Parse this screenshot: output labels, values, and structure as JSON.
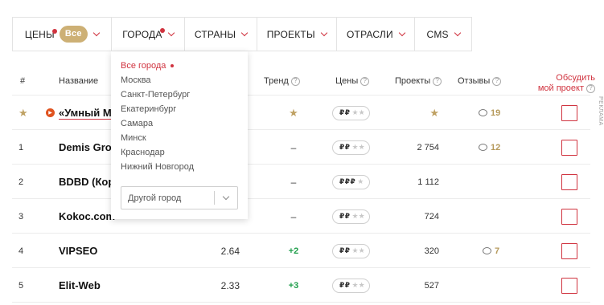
{
  "filters": [
    {
      "label": "Цены",
      "badge": "Все",
      "dot": true
    },
    {
      "label": "Города",
      "badge": "",
      "dot": true
    },
    {
      "label": "Страны",
      "badge": "",
      "dot": false
    },
    {
      "label": "Проекты",
      "badge": "",
      "dot": false
    },
    {
      "label": "Отрасли",
      "badge": "",
      "dot": false
    },
    {
      "label": "CMS",
      "badge": "",
      "dot": false
    }
  ],
  "city_dropdown": {
    "options": [
      "Все города",
      "Москва",
      "Санкт-Петербург",
      "Екатеринбург",
      "Самара",
      "Минск",
      "Краснодар",
      "Нижний Новгород"
    ],
    "selected": "Все города",
    "other_city_placeholder": "Другой город"
  },
  "table_header": {
    "rank": "#",
    "name": "Название",
    "trend": "Тренд",
    "prices": "Цены",
    "projects": "Проекты",
    "reviews": "Отзывы",
    "discuss_line1": "Обсудить",
    "discuss_line2": "мой проект",
    "help_mark": "?"
  },
  "side_label": "РЕКЛАМА",
  "rows": [
    {
      "rank": "",
      "rank_icon": "star-icon",
      "name": "«Умный Ма",
      "promo": true,
      "rating": "",
      "trend": "",
      "trend_icon": "star-icon",
      "price_filled": "₽₽",
      "price_dim": "★★",
      "projects": "",
      "projects_icon": "star-icon",
      "reviews": "19"
    },
    {
      "rank": "1",
      "name": "Demis Grou",
      "promo": false,
      "rating": "",
      "trend": "–",
      "price_filled": "₽₽",
      "price_dim": "★★",
      "projects": "2 754",
      "reviews": "12"
    },
    {
      "rank": "2",
      "name": "BDBD (Кор",
      "promo": false,
      "rating": "",
      "trend": "–",
      "price_filled": "₽₽₽",
      "price_dim": "★",
      "projects": "1 112",
      "reviews": ""
    },
    {
      "rank": "3",
      "name": "Kokoc.com",
      "promo": false,
      "rating": "",
      "trend": "–",
      "price_filled": "₽₽",
      "price_dim": "★★",
      "projects": "724",
      "reviews": ""
    },
    {
      "rank": "4",
      "name": "VIPSEO",
      "promo": false,
      "rating": "2.64",
      "trend": "+2",
      "price_filled": "₽₽",
      "price_dim": "★★",
      "projects": "320",
      "reviews": "7"
    },
    {
      "rank": "5",
      "name": "Elit-Web",
      "promo": false,
      "rating": "2.33",
      "trend": "+3",
      "price_filled": "₽₽",
      "price_dim": "★★",
      "projects": "527",
      "reviews": ""
    }
  ],
  "colors": {
    "accent": "#d0333f",
    "gold": "#cdb075",
    "trend_up": "#1f9e4b"
  }
}
